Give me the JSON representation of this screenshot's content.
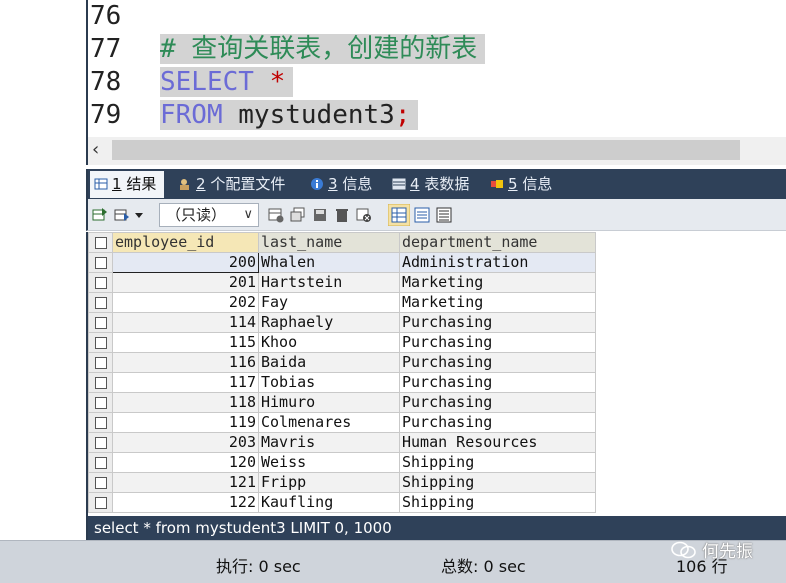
{
  "editor": {
    "line_numbers": [
      "76",
      "77",
      "78",
      "79"
    ],
    "lines": {
      "l77_comment": "# 查询关联表，创建的新表",
      "l78_keyword": "SELECT",
      "l78_star": "*",
      "l79_keyword": "FROM",
      "l79_rest": " mystudent3",
      "l79_semicolon": ";"
    }
  },
  "scrollbar": {
    "left_arrow": "‹"
  },
  "tabs": [
    {
      "num": "1",
      "label": " 结果",
      "icon": "grid-icon"
    },
    {
      "num": "2",
      "label": " 个配置文件",
      "icon": "profile-icon"
    },
    {
      "num": "3",
      "label": " 信息",
      "icon": "info-icon"
    },
    {
      "num": "4",
      "label": " 表数据",
      "icon": "table-icon"
    },
    {
      "num": "5",
      "label": " 信息",
      "icon": "info-icon"
    }
  ],
  "toolbar": {
    "readonly_label": "（只读）",
    "dropdown_glyph": "∨"
  },
  "grid": {
    "columns": [
      "employee_id",
      "last_name",
      "department_name"
    ],
    "rows": [
      [
        "200",
        "Whalen",
        "Administration"
      ],
      [
        "201",
        "Hartstein",
        "Marketing"
      ],
      [
        "202",
        "Fay",
        "Marketing"
      ],
      [
        "114",
        "Raphaely",
        "Purchasing"
      ],
      [
        "115",
        "Khoo",
        "Purchasing"
      ],
      [
        "116",
        "Baida",
        "Purchasing"
      ],
      [
        "117",
        "Tobias",
        "Purchasing"
      ],
      [
        "118",
        "Himuro",
        "Purchasing"
      ],
      [
        "119",
        "Colmenares",
        "Purchasing"
      ],
      [
        "203",
        "Mavris",
        "Human Resources"
      ],
      [
        "120",
        "Weiss",
        "Shipping"
      ],
      [
        "121",
        "Fripp",
        "Shipping"
      ],
      [
        "122",
        "Kaufling",
        "Shipping"
      ]
    ]
  },
  "query_status": "select * from mystudent3 LIMIT 0, 1000",
  "status_bar": {
    "exec_time": "执行: 0 sec",
    "total_time": "总数: 0 sec",
    "rows": "106 行"
  },
  "watermark": "何先振",
  "colors": {
    "tab_bar": "#2f4159",
    "selection": "#d3d3d3",
    "comment": "#2e8b57",
    "keyword": "#6b6bd6",
    "star": "#c00000",
    "sorted_header": "#f5e7b6"
  }
}
